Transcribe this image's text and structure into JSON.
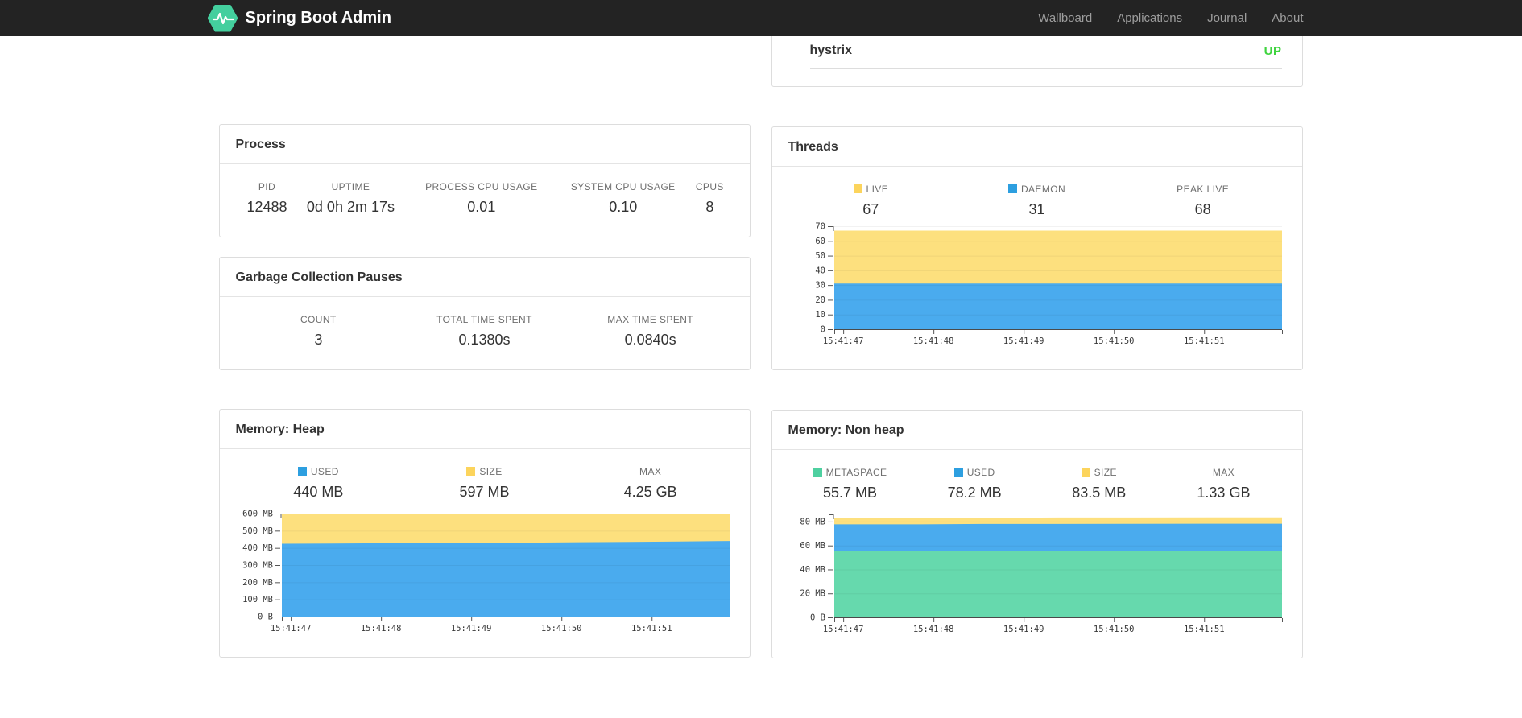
{
  "navbar": {
    "brand": "Spring Boot Admin",
    "brand_color": "#44cf9e",
    "links": [
      {
        "label": "Wallboard"
      },
      {
        "label": "Applications"
      },
      {
        "label": "Journal"
      },
      {
        "label": "About"
      }
    ]
  },
  "status_card": {
    "service_name": "hystrix",
    "status": "UP",
    "status_color": "#3fd43f"
  },
  "cards": {
    "process": {
      "title": "Process",
      "stats": [
        {
          "label": "PID",
          "value": "12488"
        },
        {
          "label": "UPTIME",
          "value": "0d 0h 2m 17s"
        },
        {
          "label": "PROCESS CPU USAGE",
          "value": "0.01"
        },
        {
          "label": "SYSTEM CPU USAGE",
          "value": "0.10"
        },
        {
          "label": "CPUS",
          "value": "8"
        }
      ]
    },
    "gc": {
      "title": "Garbage Collection Pauses",
      "stats": [
        {
          "label": "COUNT",
          "value": "3"
        },
        {
          "label": "TOTAL TIME SPENT",
          "value": "0.1380s"
        },
        {
          "label": "MAX TIME SPENT",
          "value": "0.0840s"
        }
      ]
    },
    "threads": {
      "title": "Threads",
      "stats": [
        {
          "label": "LIVE",
          "value": "67",
          "color": "#fcd45c"
        },
        {
          "label": "DAEMON",
          "value": "31",
          "color": "#2d9fe0"
        },
        {
          "label": "PEAK LIVE",
          "value": "68"
        }
      ]
    },
    "heap": {
      "title": "Memory: Heap",
      "stats": [
        {
          "label": "USED",
          "value": "440 MB",
          "color": "#2d9fe0"
        },
        {
          "label": "SIZE",
          "value": "597 MB",
          "color": "#fcd45c"
        },
        {
          "label": "MAX",
          "value": "4.25 GB"
        }
      ]
    },
    "nonheap": {
      "title": "Memory: Non heap",
      "stats": [
        {
          "label": "METASPACE",
          "value": "55.7 MB",
          "color": "#4ed0a0"
        },
        {
          "label": "USED",
          "value": "78.2 MB",
          "color": "#2d9fe0"
        },
        {
          "label": "SIZE",
          "value": "83.5 MB",
          "color": "#fcd45c"
        },
        {
          "label": "MAX",
          "value": "1.33 GB"
        }
      ]
    }
  },
  "chart_data": [
    {
      "id": "threads",
      "type": "area",
      "title": "Threads",
      "ylim": [
        0,
        70
      ],
      "grid": true,
      "legend_position": "above",
      "yticks": [
        {
          "v": 0,
          "label": "0"
        },
        {
          "v": 10,
          "label": "10"
        },
        {
          "v": 20,
          "label": "20"
        },
        {
          "v": 30,
          "label": "30"
        },
        {
          "v": 40,
          "label": "40"
        },
        {
          "v": 50,
          "label": "50"
        },
        {
          "v": 60,
          "label": "60"
        },
        {
          "v": 70,
          "label": "70"
        }
      ],
      "x_labels": [
        "15:41:47",
        "15:41:48",
        "15:41:49",
        "15:41:50",
        "15:41:51"
      ],
      "x_tick_fracs": [
        0.02,
        0.2215,
        0.423,
        0.6245,
        0.826
      ],
      "series": [
        {
          "name": "LIVE",
          "color": "#fde07e",
          "values": [
            67,
            67
          ]
        },
        {
          "name": "DAEMON",
          "color": "#4aabee",
          "values": [
            31,
            31
          ]
        }
      ]
    },
    {
      "id": "heap",
      "type": "area",
      "title": "Memory: Heap",
      "ylim": [
        0,
        600
      ],
      "grid": true,
      "legend_position": "above",
      "yticks": [
        {
          "v": 0,
          "label": "0 B"
        },
        {
          "v": 100,
          "label": "100 MB"
        },
        {
          "v": 200,
          "label": "200 MB"
        },
        {
          "v": 300,
          "label": "300 MB"
        },
        {
          "v": 400,
          "label": "400 MB"
        },
        {
          "v": 500,
          "label": "500 MB"
        },
        {
          "v": 600,
          "label": "600 MB"
        }
      ],
      "x_labels": [
        "15:41:47",
        "15:41:48",
        "15:41:49",
        "15:41:50",
        "15:41:51"
      ],
      "x_tick_fracs": [
        0.02,
        0.2215,
        0.423,
        0.6245,
        0.826
      ],
      "series": [
        {
          "name": "SIZE",
          "color": "#fde07e",
          "values": [
            597,
            597
          ]
        },
        {
          "name": "USED",
          "color": "#4aabee",
          "values": [
            424,
            425,
            427,
            428,
            430,
            431,
            433,
            435,
            437,
            440
          ]
        }
      ]
    },
    {
      "id": "nonheap",
      "type": "area",
      "title": "Memory: Non heap",
      "ylim": [
        0,
        86
      ],
      "grid": true,
      "legend_position": "above",
      "yticks": [
        {
          "v": 0,
          "label": "0 B"
        },
        {
          "v": 20,
          "label": "20 MB"
        },
        {
          "v": 40,
          "label": "40 MB"
        },
        {
          "v": 60,
          "label": "60 MB"
        },
        {
          "v": 80,
          "label": "80 MB"
        }
      ],
      "x_labels": [
        "15:41:47",
        "15:41:48",
        "15:41:49",
        "15:41:50",
        "15:41:51"
      ],
      "x_tick_fracs": [
        0.02,
        0.2215,
        0.423,
        0.6245,
        0.826
      ],
      "series": [
        {
          "name": "SIZE",
          "color": "#fde07e",
          "values": [
            83.1,
            83.1,
            83.1,
            83.4,
            83.4,
            83.5,
            83.5
          ]
        },
        {
          "name": "USED",
          "color": "#4aabee",
          "values": [
            77.7,
            77.7,
            78.0,
            78.0,
            78.1,
            78.2,
            78.2
          ]
        },
        {
          "name": "METASPACE",
          "color": "#66d9ad",
          "values": [
            55.4,
            55.4,
            55.6,
            55.6,
            55.7,
            55.7,
            55.7
          ]
        }
      ]
    }
  ]
}
